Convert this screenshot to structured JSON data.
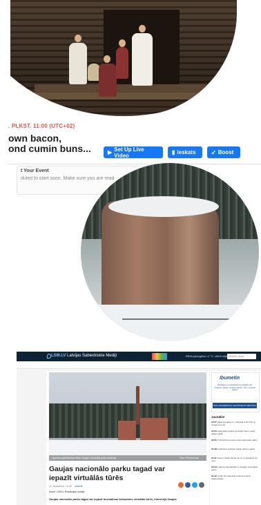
{
  "facebook": {
    "time_label": ". PLKST. 11:00 (UTC+02)",
    "event_title": "own bacon,\nond cumin buns...",
    "buttons": {
      "setup_live": "Set Up Live Video",
      "insights": "Ieskats",
      "boost": "Boost"
    },
    "section_title": "t Your Event",
    "section_sub": "duled to start soon. Make sure you are read"
  },
  "lsm": {
    "logo": "LSM.LV",
    "site_name": "Latvijas Sabiedriskie Mediji",
    "weather": "RĪGA pieregrība   +2 °C, vēlīdi vējš, 2.7m/s",
    "search_placeholder": "Meklēt ziņas",
    "headline": "Gaujas nacionālo parku tagad var iepazīt virtuālās tūrēs",
    "caption_left": "Līgatnes papīrfabrikas ēkas Gaujas nacionālā parka teritorijā",
    "caption_right": "Foto: Pexels fhoto",
    "date": "21. decembris, 10:28",
    "category": "Izklaide",
    "author": "Autori: LSM.lv Redakcijas nodaļa",
    "lead": "Gaujas nacionālo parku tagad var iepazīt bezmaksas tiešsaistes virtuālās tūrēs, informēja Gaujas",
    "ad": {
      "logo": "Ibumetin",
      "text": "Pretsāpju un pretiekaisuma līdzeklis pret muguras, galvas, locītavu sāpēm, zobu un kaulu sāpēm",
      "button": "ZĀLU INFORMĀCIJU LIETOŠANA IR OBLIGĀTA SKOLAS UZMANĪGI"
    },
    "news_title": "Jaunākie",
    "news": [
      {
        "time": "13:57",
        "text": "Daļēji apmācies un noskrējieni būs lieli un sniega sezonai"
      },
      {
        "time": "13:53",
        "text": "Gada laikā nedara vēl daudz dienu valsts paliek vairāk"
      },
      {
        "time": "13:50",
        "text": "Tirdzniecības vietas centrā pārtraukts darbs"
      },
      {
        "time": "13:48",
        "text": "Noslēdzies festivāls Sajūtu dārzs Līgatnē"
      },
      {
        "time": "13:47",
        "text": "Jauna izstāde tautas nams un saulgrieži pie upes"
      },
      {
        "time": "13:44",
        "text": "Līgatnes papīrfabrika un Gaujas nacionālais parks"
      },
      {
        "time": "13:42",
        "text": "Covid-19 ierobežojumi dienā turpina sašaurināties"
      }
    ]
  }
}
